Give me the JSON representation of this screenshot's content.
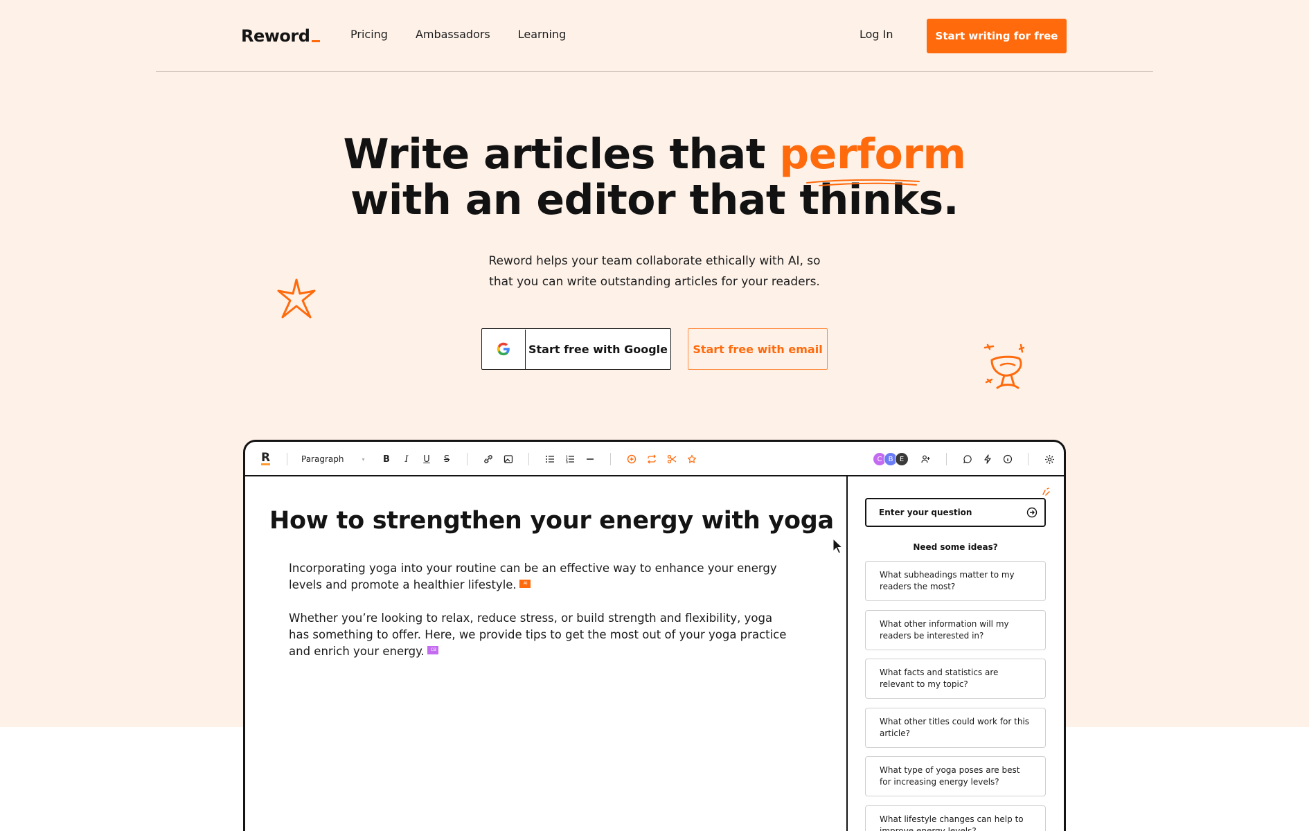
{
  "nav": {
    "logo": "Reword",
    "links": [
      "Pricing",
      "Ambassadors",
      "Learning"
    ],
    "login": "Log In",
    "cta": "Start writing for free"
  },
  "hero": {
    "title_part1": "Write articles that ",
    "title_accent": "perform",
    "title_line2": "with an editor that thinks.",
    "subtitle": "Reword helps your team collaborate ethically with AI, so that you can write outstanding articles for your readers.",
    "google_button": "Start free with Google",
    "email_button": "Start free with email"
  },
  "editor": {
    "toolbar": {
      "logo_letter": "R",
      "block_style": "Paragraph",
      "avatars": [
        {
          "letter": "C",
          "color": "#c36cf0"
        },
        {
          "letter": "B",
          "color": "#6b7cf5"
        },
        {
          "letter": "E",
          "color": "#3a3a3a"
        }
      ]
    },
    "doc": {
      "title": "How to strengthen your energy with yoga",
      "paragraph1": "Incorporating yoga into your routine can be an effective way to enhance your energy levels and promote a healthier lifestyle.",
      "paragraph2": "Whether you’re looking to relax, reduce stress, or build strength and flexibility, yoga has something to offer. Here, we provide tips to get the most out of your yoga practice and enrich your energy.",
      "flag1": {
        "label": "AI",
        "color": "#ff6a0c"
      },
      "flag2": {
        "label": "CB",
        "color": "#c36cf0"
      }
    },
    "assistant": {
      "input_placeholder": "Enter your question",
      "ideas_title": "Need some ideas?",
      "ideas": [
        "What subheadings matter to my readers the most?",
        "What other information will my readers be interested in?",
        "What facts and statistics are relevant to my topic?",
        "What other titles could work for this article?",
        "What type of yoga poses are best for increasing energy levels?",
        "What lifestyle changes can help to improve energy levels?"
      ]
    }
  },
  "colors": {
    "accent": "#ff6a0c",
    "background": "#fdf1e8",
    "text": "#141414"
  }
}
